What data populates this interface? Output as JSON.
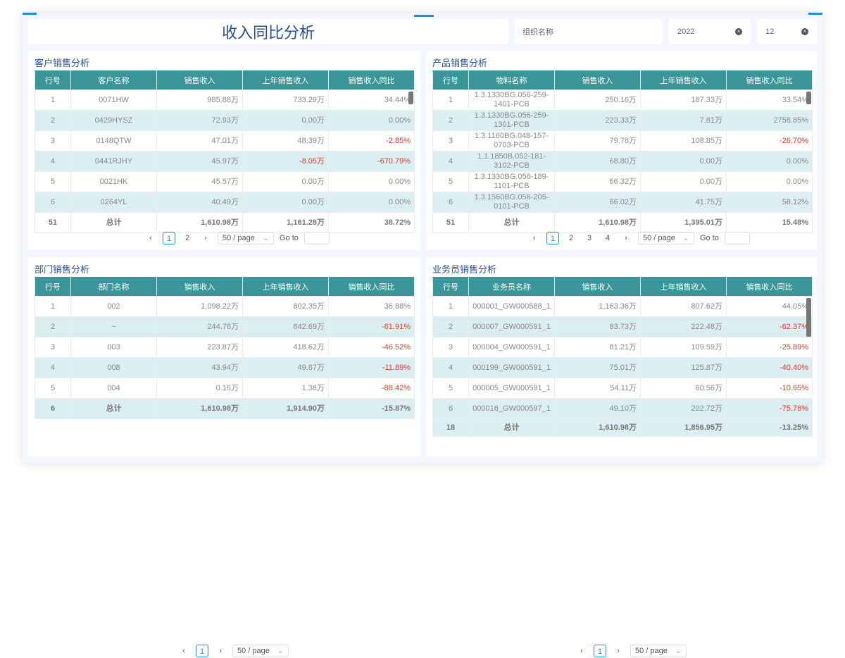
{
  "header": {
    "title": "收入同比分析",
    "org_placeholder": "组织名称",
    "year": "2022",
    "month": "12"
  },
  "columns_common": [
    "行号",
    "销售收入",
    "上年销售收入",
    "销售收入同比"
  ],
  "panels": [
    {
      "title": "客户销售分析",
      "name_col": "客户名称",
      "rows": [
        [
          "1",
          "0071HW",
          "985.88万",
          "733.29万",
          "34.44%"
        ],
        [
          "2",
          "0429HYSZ",
          "72.93万",
          "0.00万",
          "0.00%"
        ],
        [
          "3",
          "0148QTW",
          "47.01万",
          "48.39万",
          "-2.85%"
        ],
        [
          "4",
          "0441RJHY",
          "45.97万",
          "-8.05万",
          "-670.79%"
        ],
        [
          "5",
          "0021HK",
          "45.57万",
          "0.00万",
          "0.00%"
        ],
        [
          "6",
          "0264YL",
          "40.49万",
          "0.00万",
          "0.00%"
        ]
      ],
      "total": [
        "51",
        "总计",
        "1,610.98万",
        "1,161.28万",
        "38.72%"
      ],
      "pages": [
        "1",
        "2"
      ],
      "page_size": "50 / page",
      "goto": "Go to"
    },
    {
      "title": "产品销售分析",
      "name_col": "物料名称",
      "rows": [
        [
          "1",
          "1.3.1330BG.056-259-1401-PCB",
          "250.16万",
          "187.33万",
          "33.54%"
        ],
        [
          "2",
          "1.3.1330BG.056-259-1301-PCB",
          "223.33万",
          "7.81万",
          "2758.85%"
        ],
        [
          "3",
          "1.3.1160BG.048-157-0703-PCB",
          "79.78万",
          "108.85万",
          "-26.70%"
        ],
        [
          "4",
          "1.1.1850B.052-181-3102-PCB",
          "68.80万",
          "0.00万",
          "0.00%"
        ],
        [
          "5",
          "1.3.1330BG.056-189-1101-PCB",
          "66.32万",
          "0.00万",
          "0.00%"
        ],
        [
          "6",
          "1.3.1560BG.056-205-0101-PCB",
          "66.02万",
          "41.75万",
          "58.12%"
        ]
      ],
      "total": [
        "51",
        "总计",
        "1,610.98万",
        "1,395.01万",
        "15.48%"
      ],
      "pages": [
        "1",
        "2",
        "3",
        "4"
      ],
      "page_size": "50 / page",
      "goto": "Go to"
    },
    {
      "title": "部门销售分析",
      "name_col": "部门名称",
      "rows": [
        [
          "1",
          "002",
          "1,098.22万",
          "802.35万",
          "36.88%"
        ],
        [
          "2",
          "~",
          "244.78万",
          "642.69万",
          "-61.91%"
        ],
        [
          "3",
          "003",
          "223.87万",
          "418.62万",
          "-46.52%"
        ],
        [
          "4",
          "008",
          "43.94万",
          "49.87万",
          "-11.89%"
        ],
        [
          "5",
          "004",
          "0.16万",
          "1.38万",
          "-88.42%"
        ]
      ],
      "total": [
        "6",
        "总计",
        "1,610.98万",
        "1,914.90万",
        "-15.87%"
      ],
      "pages": [
        "1"
      ],
      "page_size": "50 / page"
    },
    {
      "title": "业务员销售分析",
      "name_col": "业务员名称",
      "rows": [
        [
          "1",
          "000001_GW000588_1",
          "1,163.36万",
          "807.62万",
          "44.05%"
        ],
        [
          "2",
          "000007_GW000591_1",
          "83.73万",
          "222.48万",
          "-62.37%"
        ],
        [
          "3",
          "000004_GW000591_1",
          "81.21万",
          "109.59万",
          "-25.89%"
        ],
        [
          "4",
          "000199_GW000591_1",
          "75.01万",
          "125.87万",
          "-40.40%"
        ],
        [
          "5",
          "000005_GW000591_1",
          "54.11万",
          "60.56万",
          "-10.65%"
        ],
        [
          "6",
          "000016_GW000597_1",
          "49.10万",
          "202.72万",
          "-75.78%"
        ]
      ],
      "total": [
        "18",
        "总计",
        "1,610.98万",
        "1,856.95万",
        "-13.25%"
      ],
      "pages": [
        "1"
      ],
      "page_size": "50 / page"
    }
  ]
}
